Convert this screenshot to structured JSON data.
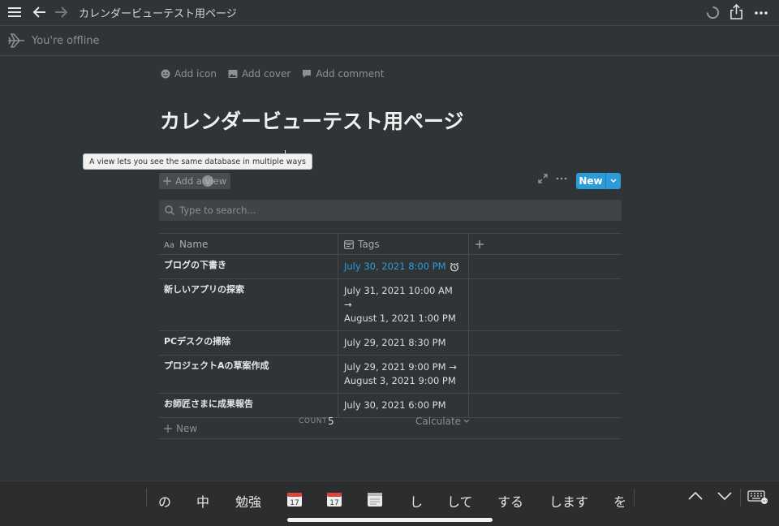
{
  "topbar": {
    "title": "カレンダービューテスト用ページ",
    "icons": [
      "menu-icon",
      "back-arrow-icon",
      "forward-arrow-icon",
      "loading-spinner-icon",
      "share-icon",
      "more-icon"
    ]
  },
  "offline_banner": {
    "text": "You're offline"
  },
  "page_actions": [
    {
      "label": "Add icon",
      "icon": "smiley-icon"
    },
    {
      "label": "Add cover",
      "icon": "image-icon"
    },
    {
      "label": "Add comment",
      "icon": "comment-icon"
    }
  ],
  "page": {
    "title": "カレンダービューテスト用ページ"
  },
  "tooltip": {
    "text": "A view lets you see the same database in multiple ways"
  },
  "db_toolbar": {
    "add_view_label": "Add a view",
    "new_label": "New"
  },
  "search": {
    "placeholder": "Type to search..."
  },
  "table": {
    "columns": [
      {
        "label": "Name",
        "icon": "text-aa-icon"
      },
      {
        "label": "Tags",
        "icon": "calendar-icon"
      }
    ],
    "rows": [
      {
        "name": "ブログの下書き",
        "date_line1": "July 30, 2021 8:00 PM",
        "date_line2": "",
        "reminder": true
      },
      {
        "name": "新しいアプリの探索",
        "date_line1": "July 31, 2021 10:00 AM →",
        "date_line2": "August 1, 2021 1:00 PM",
        "reminder": false
      },
      {
        "name": "PCデスクの掃除",
        "date_line1": "July 29, 2021 8:30 PM",
        "date_line2": "",
        "reminder": false
      },
      {
        "name": "プロジェクトAの草案作成",
        "date_line1": "July 29, 2021 9:00 PM →",
        "date_line2": "August 3, 2021 9:00 PM",
        "reminder": false
      },
      {
        "name": "お師匠さまに成果報告",
        "date_line1": "July 30, 2021 6:00 PM",
        "date_line2": "",
        "reminder": false
      }
    ],
    "new_row_label": "New"
  },
  "footer": {
    "count_label": "COUNT",
    "count_value": "5",
    "calculate_label": "Calculate"
  },
  "keyboard": {
    "candidates": [
      "の",
      "中",
      "勉強",
      "し",
      "して",
      "する",
      "します",
      "を"
    ]
  },
  "colors": {
    "background": "#2f3437",
    "accent": "#2e9bd9"
  }
}
